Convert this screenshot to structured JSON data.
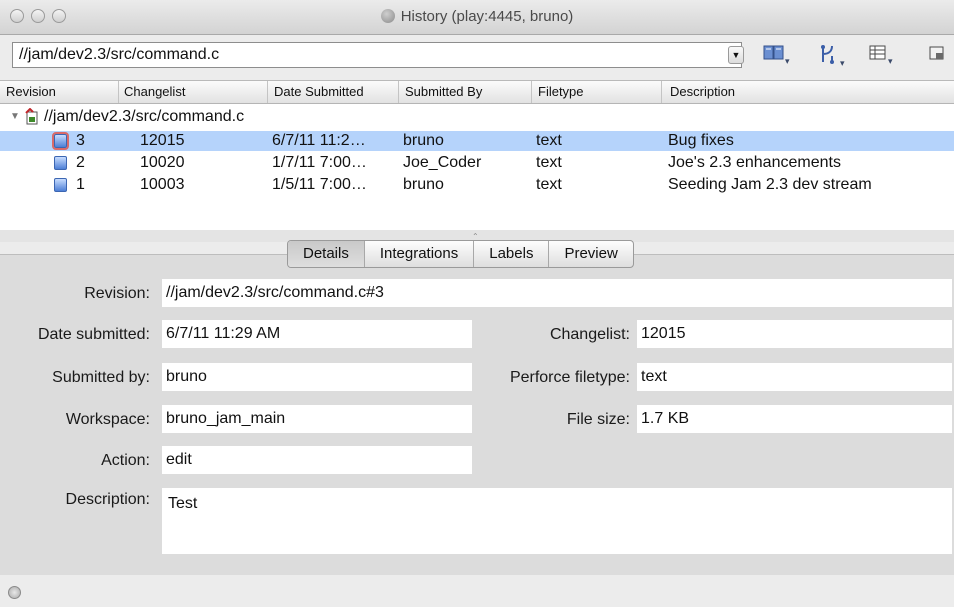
{
  "window": {
    "title": "History (play:4445, bruno)"
  },
  "toolbar": {
    "path": "//jam/dev2.3/src/command.c",
    "icons": [
      "book-icon",
      "branch-icon",
      "columns-icon",
      "panel-icon"
    ]
  },
  "list": {
    "columns": [
      "Revision",
      "Changelist",
      "Date Submitted",
      "Submitted By",
      "Filetype",
      "Description"
    ],
    "file": "//jam/dev2.3/src/command.c",
    "rows": [
      {
        "revision": "3",
        "changelist": "12015",
        "date": "6/7/11 11:2…",
        "by": "bruno",
        "filetype": "text",
        "description": "Bug fixes"
      },
      {
        "revision": "2",
        "changelist": "10020",
        "date": "1/7/11 7:00…",
        "by": "Joe_Coder",
        "filetype": "text",
        "description": "Joe's 2.3 enhancements"
      },
      {
        "revision": "1",
        "changelist": "10003",
        "date": "1/5/11 7:00…",
        "by": "bruno",
        "filetype": "text",
        "description": "Seeding Jam 2.3 dev stream"
      }
    ]
  },
  "tabs": [
    "Details",
    "Integrations",
    "Labels",
    "Preview"
  ],
  "details": {
    "revision_label": "Revision:",
    "revision": "//jam/dev2.3/src/command.c#3",
    "date_label": "Date submitted:",
    "date": "6/7/11 11:29 AM",
    "changelist_label": "Changelist:",
    "changelist": "12015",
    "by_label": "Submitted by:",
    "by": "bruno",
    "filetype_label": "Perforce filetype:",
    "filetype": "text",
    "workspace_label": "Workspace:",
    "workspace": "bruno_jam_main",
    "filesize_label": "File size:",
    "filesize": "1.7 KB",
    "action_label": "Action:",
    "action": "edit",
    "description_label": "Description:",
    "description": "Test"
  },
  "colors": {
    "selection": "#b5d3fb",
    "panel": "#dcdcdc"
  }
}
